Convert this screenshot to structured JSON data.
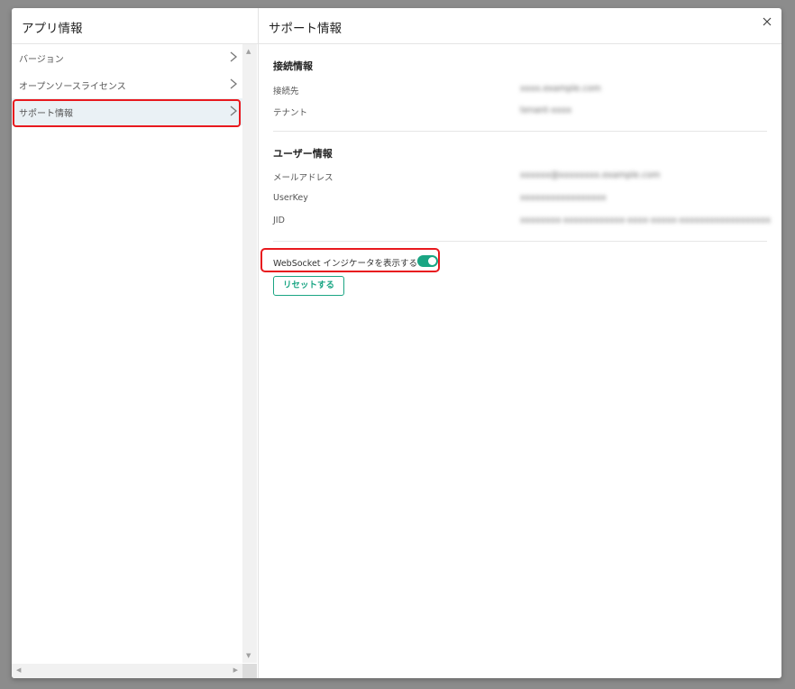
{
  "left_panel": {
    "title": "アプリ情報",
    "items": [
      {
        "label": "バージョン"
      },
      {
        "label": "オープンソースライセンス"
      },
      {
        "label": "サポート情報"
      }
    ]
  },
  "right_panel": {
    "title": "サポート情報",
    "connection": {
      "heading": "接続情報",
      "fields": [
        {
          "label": "接続先",
          "value": "xxxx.example.com"
        },
        {
          "label": "テナント",
          "value": "tenant-xxxx"
        }
      ]
    },
    "user": {
      "heading": "ユーザー情報",
      "fields": [
        {
          "label": "メールアドレス",
          "value": "xxxxxx@xxxxxxxx.example.com"
        },
        {
          "label": "UserKey",
          "value": "xxxxxxxxxxxxxxxxx"
        },
        {
          "label": "JID",
          "value": "xxxxxxxx-xxxxxxxxxxxx-xxxx-xxxxx-xxxxxxxxxxxxxxxxxx"
        }
      ]
    },
    "websocket_indicator": {
      "label": "WebSocket インジケータを表示する",
      "enabled": true
    },
    "reset_button": "リセットする"
  },
  "colors": {
    "accent": "#1aa583",
    "highlight": "#e8191e",
    "selected_bg": "#eaf1f5"
  },
  "icons": {
    "close": "close-icon",
    "chevron": "chevron-right-icon"
  }
}
